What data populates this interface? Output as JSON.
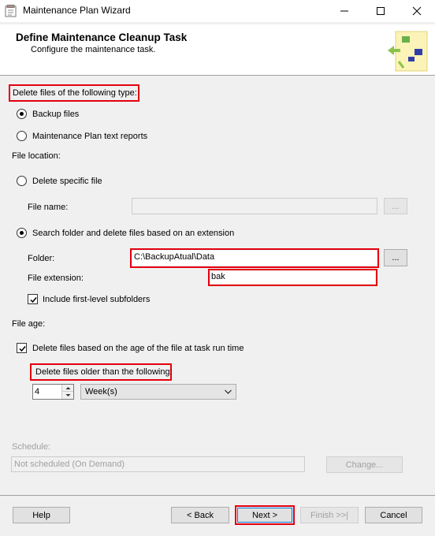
{
  "window": {
    "title": "Maintenance Plan Wizard"
  },
  "header": {
    "title": "Define Maintenance Cleanup Task",
    "subtitle": "Configure the maintenance task."
  },
  "file_type": {
    "label": "Delete files of the following type:",
    "options": [
      {
        "label": "Backup files",
        "selected": true
      },
      {
        "label": "Maintenance Plan text reports",
        "selected": false
      }
    ]
  },
  "file_location": {
    "label": "File location:",
    "delete_specific": {
      "label": "Delete specific file",
      "selected": false
    },
    "file_name": {
      "label": "File name:",
      "value": ""
    },
    "search_folder": {
      "label": "Search folder and delete files based on an extension",
      "selected": true
    },
    "folder": {
      "label": "Folder:",
      "value": "C:\\BackupAtual\\Data"
    },
    "extension": {
      "label": "File extension:",
      "value": "bak"
    },
    "include_subfolders": {
      "label": "Include first-level subfolders",
      "checked": true
    },
    "browse_label": "..."
  },
  "file_age": {
    "label": "File age:",
    "delete_by_age": {
      "label": "Delete files based on the age of the file at task run time",
      "checked": true
    },
    "older_than_label": "Delete files older than the following:",
    "amount": "4",
    "unit": "Week(s)"
  },
  "schedule": {
    "label": "Schedule:",
    "value": "Not scheduled (On Demand)",
    "change_label": "Change..."
  },
  "footer": {
    "help": "Help",
    "back": "< Back",
    "next": "Next >",
    "finish": "Finish >>|",
    "cancel": "Cancel"
  },
  "colors": {
    "highlight": "#e3000f",
    "window_bg": "#f0f0f0"
  }
}
